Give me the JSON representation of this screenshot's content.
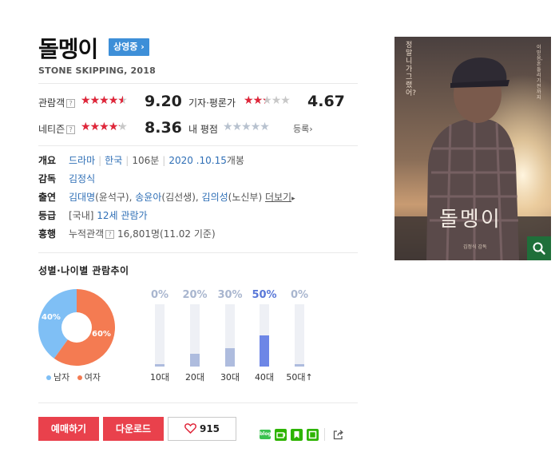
{
  "title": "돌멩이",
  "status_badge": "상영중",
  "status_arrow": "›",
  "subtitle": "STONE SKIPPING, 2018",
  "ratings": {
    "audience": {
      "label": "관람객",
      "help": "?",
      "score": "9.20",
      "stars_filled": 4.6
    },
    "critic": {
      "label": "기자·평론가",
      "score": "4.67",
      "stars_filled": 2.3
    },
    "netizen": {
      "label": "네티즌",
      "help": "?",
      "score": "8.36",
      "stars_filled": 4.2
    },
    "my_rating": {
      "label": "내 평점",
      "register_label": "등록",
      "arrow": "›"
    }
  },
  "info": {
    "overview_label": "개요",
    "genre": "드라마",
    "country": "한국",
    "runtime": "106분",
    "release_date": "2020 .10.15",
    "release_suffix": "개봉",
    "director_label": "감독",
    "director": "김정식",
    "cast_label": "출연",
    "cast": [
      {
        "name": "김대명",
        "role": "(윤석구),"
      },
      {
        "name": "송윤아",
        "role": "(김선생),"
      },
      {
        "name": "김의성",
        "role": "(노신부)"
      }
    ],
    "more_label": "더보기",
    "more_arrow": "▸",
    "grade_label": "등급",
    "grade_prefix": "[국내]",
    "grade": "12세 관람가",
    "boxoffice_label": "흥행",
    "boxoffice_prefix": "누적관객",
    "boxoffice_help": "?",
    "boxoffice_value": "16,801명(11.02 기준)"
  },
  "demographics": {
    "title": "성별·나이별 관람추이",
    "gender": [
      {
        "name": "남자",
        "pct": 40,
        "label": "40%",
        "color": "#7fbff5"
      },
      {
        "name": "여자",
        "pct": 60,
        "label": "60%",
        "color": "#f47b52"
      }
    ],
    "ages": [
      {
        "label": "10대",
        "pct": 0,
        "pct_label": "0%",
        "highlight": false
      },
      {
        "label": "20대",
        "pct": 20,
        "pct_label": "20%",
        "highlight": false
      },
      {
        "label": "30대",
        "pct": 30,
        "pct_label": "30%",
        "highlight": false
      },
      {
        "label": "40대",
        "pct": 50,
        "pct_label": "50%",
        "highlight": true
      },
      {
        "label": "50대↑",
        "pct": 0,
        "pct_label": "0%",
        "highlight": false
      }
    ]
  },
  "actions": {
    "reserve_label": "예매하기",
    "download_label": "다운로드",
    "like_count": "915",
    "share_blog_label": "blog"
  },
  "poster": {
    "vertical_text_1": "정말 니가 그랬어?",
    "vertical_text_2": "이 믿음, 흔들리기 전까지",
    "title_text": "돌멩이",
    "studio_text": "김정식 감독"
  },
  "colors": {
    "accent_red": "#e9414c",
    "badge_blue": "#3d8fd8",
    "link_blue": "#2f6fb6",
    "star_red": "#e0263a",
    "highlight_bar": "#6d86e6"
  }
}
